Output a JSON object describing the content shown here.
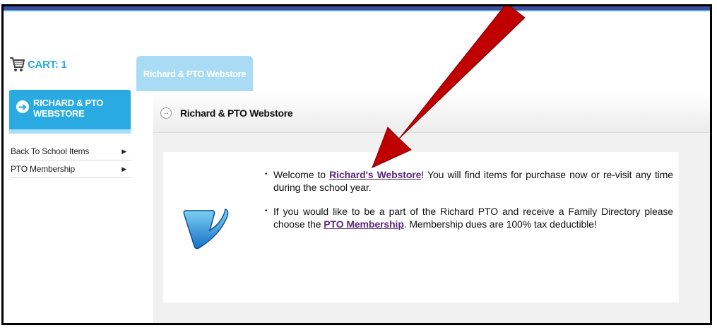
{
  "cart": {
    "label": "CART: 1"
  },
  "tab": {
    "label": "Richard & PTO Webstore"
  },
  "sidebar": {
    "header": "RICHARD & PTO WEBSTORE",
    "items": [
      {
        "label": "Back To School Items"
      },
      {
        "label": "PTO Membership"
      }
    ]
  },
  "breadcrumb": {
    "label": "Richard & PTO Webstore"
  },
  "content": {
    "p1_before": "Welcome to ",
    "p1_link": "Richard's Webstore",
    "p1_after": "! You will find items for purchase now or re-visit any time during the school year.",
    "p2_before": "If you would like to be a part of the Richard PTO and receive a Family Directory please choose the ",
    "p2_link": "PTO Membership",
    "p2_after": ". Membership dues are 100% tax deductible!"
  },
  "colors": {
    "accent": "#29abe2",
    "tab": "#a9dcf4",
    "link": "#5b2a7c",
    "arrow": "#c00000"
  }
}
